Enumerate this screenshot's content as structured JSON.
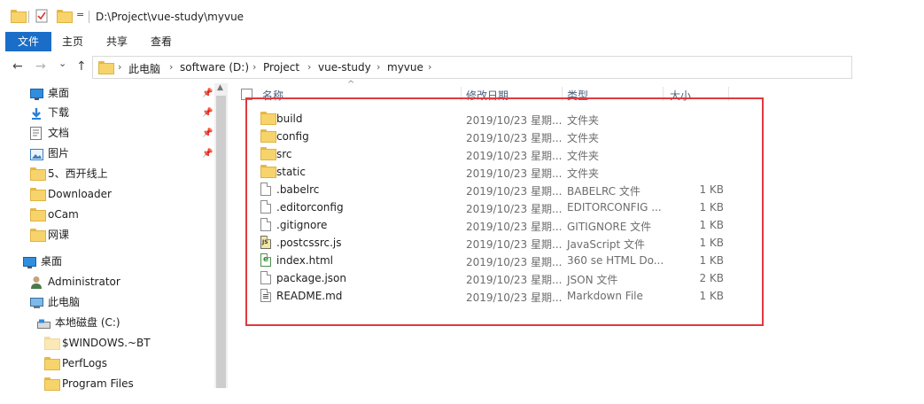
{
  "titlebar": {
    "path": "D:\\Project\\vue-study\\myvue",
    "quick_access_dropdown": "="
  },
  "ribbon": {
    "tabs": [
      {
        "label": "文件",
        "active": true
      },
      {
        "label": "主页",
        "active": false
      },
      {
        "label": "共享",
        "active": false
      },
      {
        "label": "查看",
        "active": false
      }
    ]
  },
  "nav": {
    "back": "←",
    "forward": "→",
    "recent": "⌄",
    "up": "↑"
  },
  "breadcrumb": [
    "此电脑",
    "software (D:)",
    "Project",
    "vue-study",
    "myvue"
  ],
  "sidebar": {
    "items": [
      {
        "label": "桌面",
        "icon": "desktop-icon",
        "pinned": true
      },
      {
        "label": "下载",
        "icon": "download-icon",
        "pinned": true
      },
      {
        "label": "文档",
        "icon": "document-icon",
        "pinned": true
      },
      {
        "label": "图片",
        "icon": "picture-icon",
        "pinned": true
      },
      {
        "label": "5、西开线上",
        "icon": "folder-icon",
        "pinned": false
      },
      {
        "label": "Downloader",
        "icon": "folder-icon",
        "pinned": false
      },
      {
        "label": "oCam",
        "icon": "folder-icon",
        "pinned": false
      },
      {
        "label": "网课",
        "icon": "folder-icon",
        "pinned": false
      },
      {
        "label": "桌面",
        "icon": "desktop-icon",
        "pinned": false
      },
      {
        "label": "Administrator",
        "icon": "user-icon",
        "pinned": false
      },
      {
        "label": "此电脑",
        "icon": "computer-icon",
        "pinned": false
      },
      {
        "label": "本地磁盘 (C:)",
        "icon": "drive-icon",
        "pinned": false
      },
      {
        "label": "$WINDOWS.~BT",
        "icon": "folder-icon",
        "pinned": false
      },
      {
        "label": "PerfLogs",
        "icon": "folder-icon",
        "pinned": false
      },
      {
        "label": "Program Files",
        "icon": "folder-icon",
        "pinned": false
      }
    ]
  },
  "columns": {
    "name": "名称",
    "date": "修改日期",
    "type": "类型",
    "size": "大小"
  },
  "files": [
    {
      "name": "build",
      "date": "2019/10/23 星期...",
      "type": "文件夹",
      "size": "",
      "icon": "folder"
    },
    {
      "name": "config",
      "date": "2019/10/23 星期...",
      "type": "文件夹",
      "size": "",
      "icon": "folder"
    },
    {
      "name": "src",
      "date": "2019/10/23 星期...",
      "type": "文件夹",
      "size": "",
      "icon": "folder"
    },
    {
      "name": "static",
      "date": "2019/10/23 星期...",
      "type": "文件夹",
      "size": "",
      "icon": "folder"
    },
    {
      "name": ".babelrc",
      "date": "2019/10/23 星期...",
      "type": "BABELRC 文件",
      "size": "1 KB",
      "icon": "file"
    },
    {
      "name": ".editorconfig",
      "date": "2019/10/23 星期...",
      "type": "EDITORCONFIG ...",
      "size": "1 KB",
      "icon": "file"
    },
    {
      "name": ".gitignore",
      "date": "2019/10/23 星期...",
      "type": "GITIGNORE 文件",
      "size": "1 KB",
      "icon": "file"
    },
    {
      "name": ".postcssrc.js",
      "date": "2019/10/23 星期...",
      "type": "JavaScript 文件",
      "size": "1 KB",
      "icon": "js"
    },
    {
      "name": "index.html",
      "date": "2019/10/23 星期...",
      "type": "360 se HTML Do...",
      "size": "1 KB",
      "icon": "html"
    },
    {
      "name": "package.json",
      "date": "2019/10/23 星期...",
      "type": "JSON 文件",
      "size": "2 KB",
      "icon": "file"
    },
    {
      "name": "README.md",
      "date": "2019/10/23 星期...",
      "type": "Markdown File",
      "size": "1 KB",
      "icon": "md"
    }
  ],
  "colors": {
    "ribbon_active": "#1a6ec8",
    "highlight": "#e0393e",
    "folder": "#f7d46b"
  }
}
